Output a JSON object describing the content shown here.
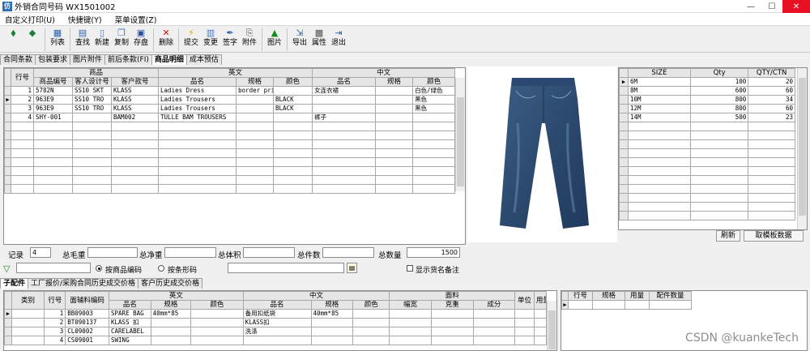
{
  "window": {
    "title": "外销合同号码  WX1501002",
    "app_icon": "仿"
  },
  "menu": [
    "自定义打印(U)",
    "快捷键(Y)",
    "菜单设置(Z)"
  ],
  "toolbar": [
    {
      "label": "",
      "icon": "◆",
      "name": "back-button",
      "color": "#1e7d3a"
    },
    {
      "label": "",
      "icon": "◆",
      "name": "forward-button",
      "color": "#1e7d3a"
    },
    {
      "sep": true
    },
    {
      "label": "列表",
      "icon": "▦",
      "name": "list-button",
      "color": "#2a62b0"
    },
    {
      "sep": true
    },
    {
      "label": "查找",
      "icon": "▤",
      "name": "search-button",
      "color": "#2a62b0"
    },
    {
      "label": "新建",
      "icon": "▯",
      "name": "new-button",
      "color": "#4a78c0"
    },
    {
      "label": "复制",
      "icon": "❐",
      "name": "copy-button",
      "color": "#4a78c0"
    },
    {
      "label": "存盘",
      "icon": "▣",
      "name": "save-button",
      "color": "#2a4ea0"
    },
    {
      "sep": true
    },
    {
      "label": "删除",
      "icon": "✕",
      "name": "delete-button",
      "color": "#d01010"
    },
    {
      "sep": true
    },
    {
      "label": "提交",
      "icon": "⚡",
      "name": "submit-button",
      "color": "#e0a000"
    },
    {
      "label": "变更",
      "icon": "▥",
      "name": "change-button",
      "color": "#4a78c0"
    },
    {
      "label": "签字",
      "icon": "✒",
      "name": "sign-button",
      "color": "#2a62b0"
    },
    {
      "label": "附件",
      "icon": "⎘",
      "name": "attach-button",
      "color": "#555555"
    },
    {
      "sep": true
    },
    {
      "label": "图片",
      "icon": "▲",
      "name": "picture-button",
      "color": "#1a8a1a"
    },
    {
      "sep": true
    },
    {
      "label": "导出",
      "icon": "⇲",
      "name": "export-button",
      "color": "#2a62b0"
    },
    {
      "label": "属性",
      "icon": "▩",
      "name": "properties-button",
      "color": "#555555"
    },
    {
      "label": "退出",
      "icon": "⇥",
      "name": "exit-button",
      "color": "#2a62b0"
    }
  ],
  "tabs_top": [
    "合同条款",
    "包装要求",
    "图片附件",
    "前后条款(FI)",
    "商品明细",
    "成本预估"
  ],
  "tabs_top_active": 4,
  "products": {
    "group_headers": {
      "c1": "商品",
      "c2": "英文",
      "c3": "中文"
    },
    "col_rowno": "行号",
    "columns": [
      "商品编号",
      "客人设计号",
      "客户款号",
      "品名",
      "规格",
      "颜色",
      "品名",
      "规格",
      "颜色"
    ],
    "rows": [
      {
        "n": "1",
        "cells": [
          "5782N",
          "SS10 SKT",
          "KLASS",
          "Ladies Dress",
          "border prir",
          "",
          "女连衣裙",
          "",
          "白色/绿色"
        ]
      },
      {
        "n": "2",
        "cells": [
          "963E9",
          "SS10 TRO",
          "KLASS",
          "Ladies Trousers",
          "",
          "BLACK",
          "",
          "",
          "黑色"
        ]
      },
      {
        "n": "3",
        "cells": [
          "963E9",
          "SS10 TRO",
          "KLASS",
          "Ladies Trousers",
          "",
          "BLACK",
          "",
          "",
          "黑色"
        ]
      },
      {
        "n": "4",
        "cells": [
          "SHY-001",
          "",
          "BAM002",
          "TULLE BAM TROUSERS",
          "",
          "",
          "裤子",
          "",
          ""
        ]
      }
    ],
    "current_row": 1
  },
  "image_nav": {
    "prev": "⇦",
    "next": "⇨"
  },
  "sizes": {
    "columns": [
      "SIZE",
      "Qty",
      "QTY/CTN"
    ],
    "rows": [
      [
        "6M",
        "100",
        "20"
      ],
      [
        "8M",
        "600",
        "60"
      ],
      [
        "10M",
        "800",
        "34"
      ],
      [
        "12M",
        "800",
        "60"
      ],
      [
        "14M",
        "500",
        "23"
      ]
    ]
  },
  "buttons": {
    "refresh": "刷新",
    "template": "取模板数据"
  },
  "summary": {
    "record_label": "记录",
    "record_value": "4",
    "gross_label": "总毛重",
    "net_label": "总净重",
    "volume_label": "总体积",
    "pieces_label": "总件数",
    "qty_label": "总数量",
    "qty_value": "1500"
  },
  "filter": {
    "radio_product": "按商品编码",
    "radio_barcode": "按条形码",
    "show_note": "显示货名备注"
  },
  "tabs_bottom": [
    "子配件",
    "工厂报价/采购合同历史成交价格",
    "客户历史成交价格"
  ],
  "tabs_bottom_active": 0,
  "accessories": {
    "group_headers": {
      "en": "英文",
      "cn": "中文",
      "fabric": "面料"
    },
    "col_type": "类别",
    "col_rowno": "行号",
    "col_code": "面辅料编码",
    "columns": [
      "品名",
      "规格",
      "颜色",
      "品名",
      "规格",
      "颜色",
      "幅宽",
      "克重",
      "成分"
    ],
    "col_unit": "单位",
    "col_qty": "用量",
    "rows": [
      {
        "n": "1",
        "code": "BB09003",
        "cells": [
          "SPARE BAG",
          "40mm*85",
          "",
          "备用扣纸袋",
          "40mm*85",
          "",
          "",
          "",
          ""
        ]
      },
      {
        "n": "2",
        "code": "BT090137",
        "cells": [
          "KLASS 扣",
          "",
          "",
          "KLASS扣",
          "",
          "",
          "",
          "",
          ""
        ]
      },
      {
        "n": "3",
        "code": "CL09002",
        "cells": [
          "CARELABEL",
          "",
          "",
          "洗涤",
          "",
          "",
          "",
          "",
          ""
        ]
      },
      {
        "n": "4",
        "code": "CS09001",
        "cells": [
          "SWING",
          "",
          "",
          "",
          "",
          "",
          "",
          "",
          ""
        ]
      }
    ]
  },
  "parts": {
    "columns": [
      "行号",
      "规格",
      "用量",
      "配件数量"
    ]
  },
  "watermark": "CSDN @kuankeTech"
}
